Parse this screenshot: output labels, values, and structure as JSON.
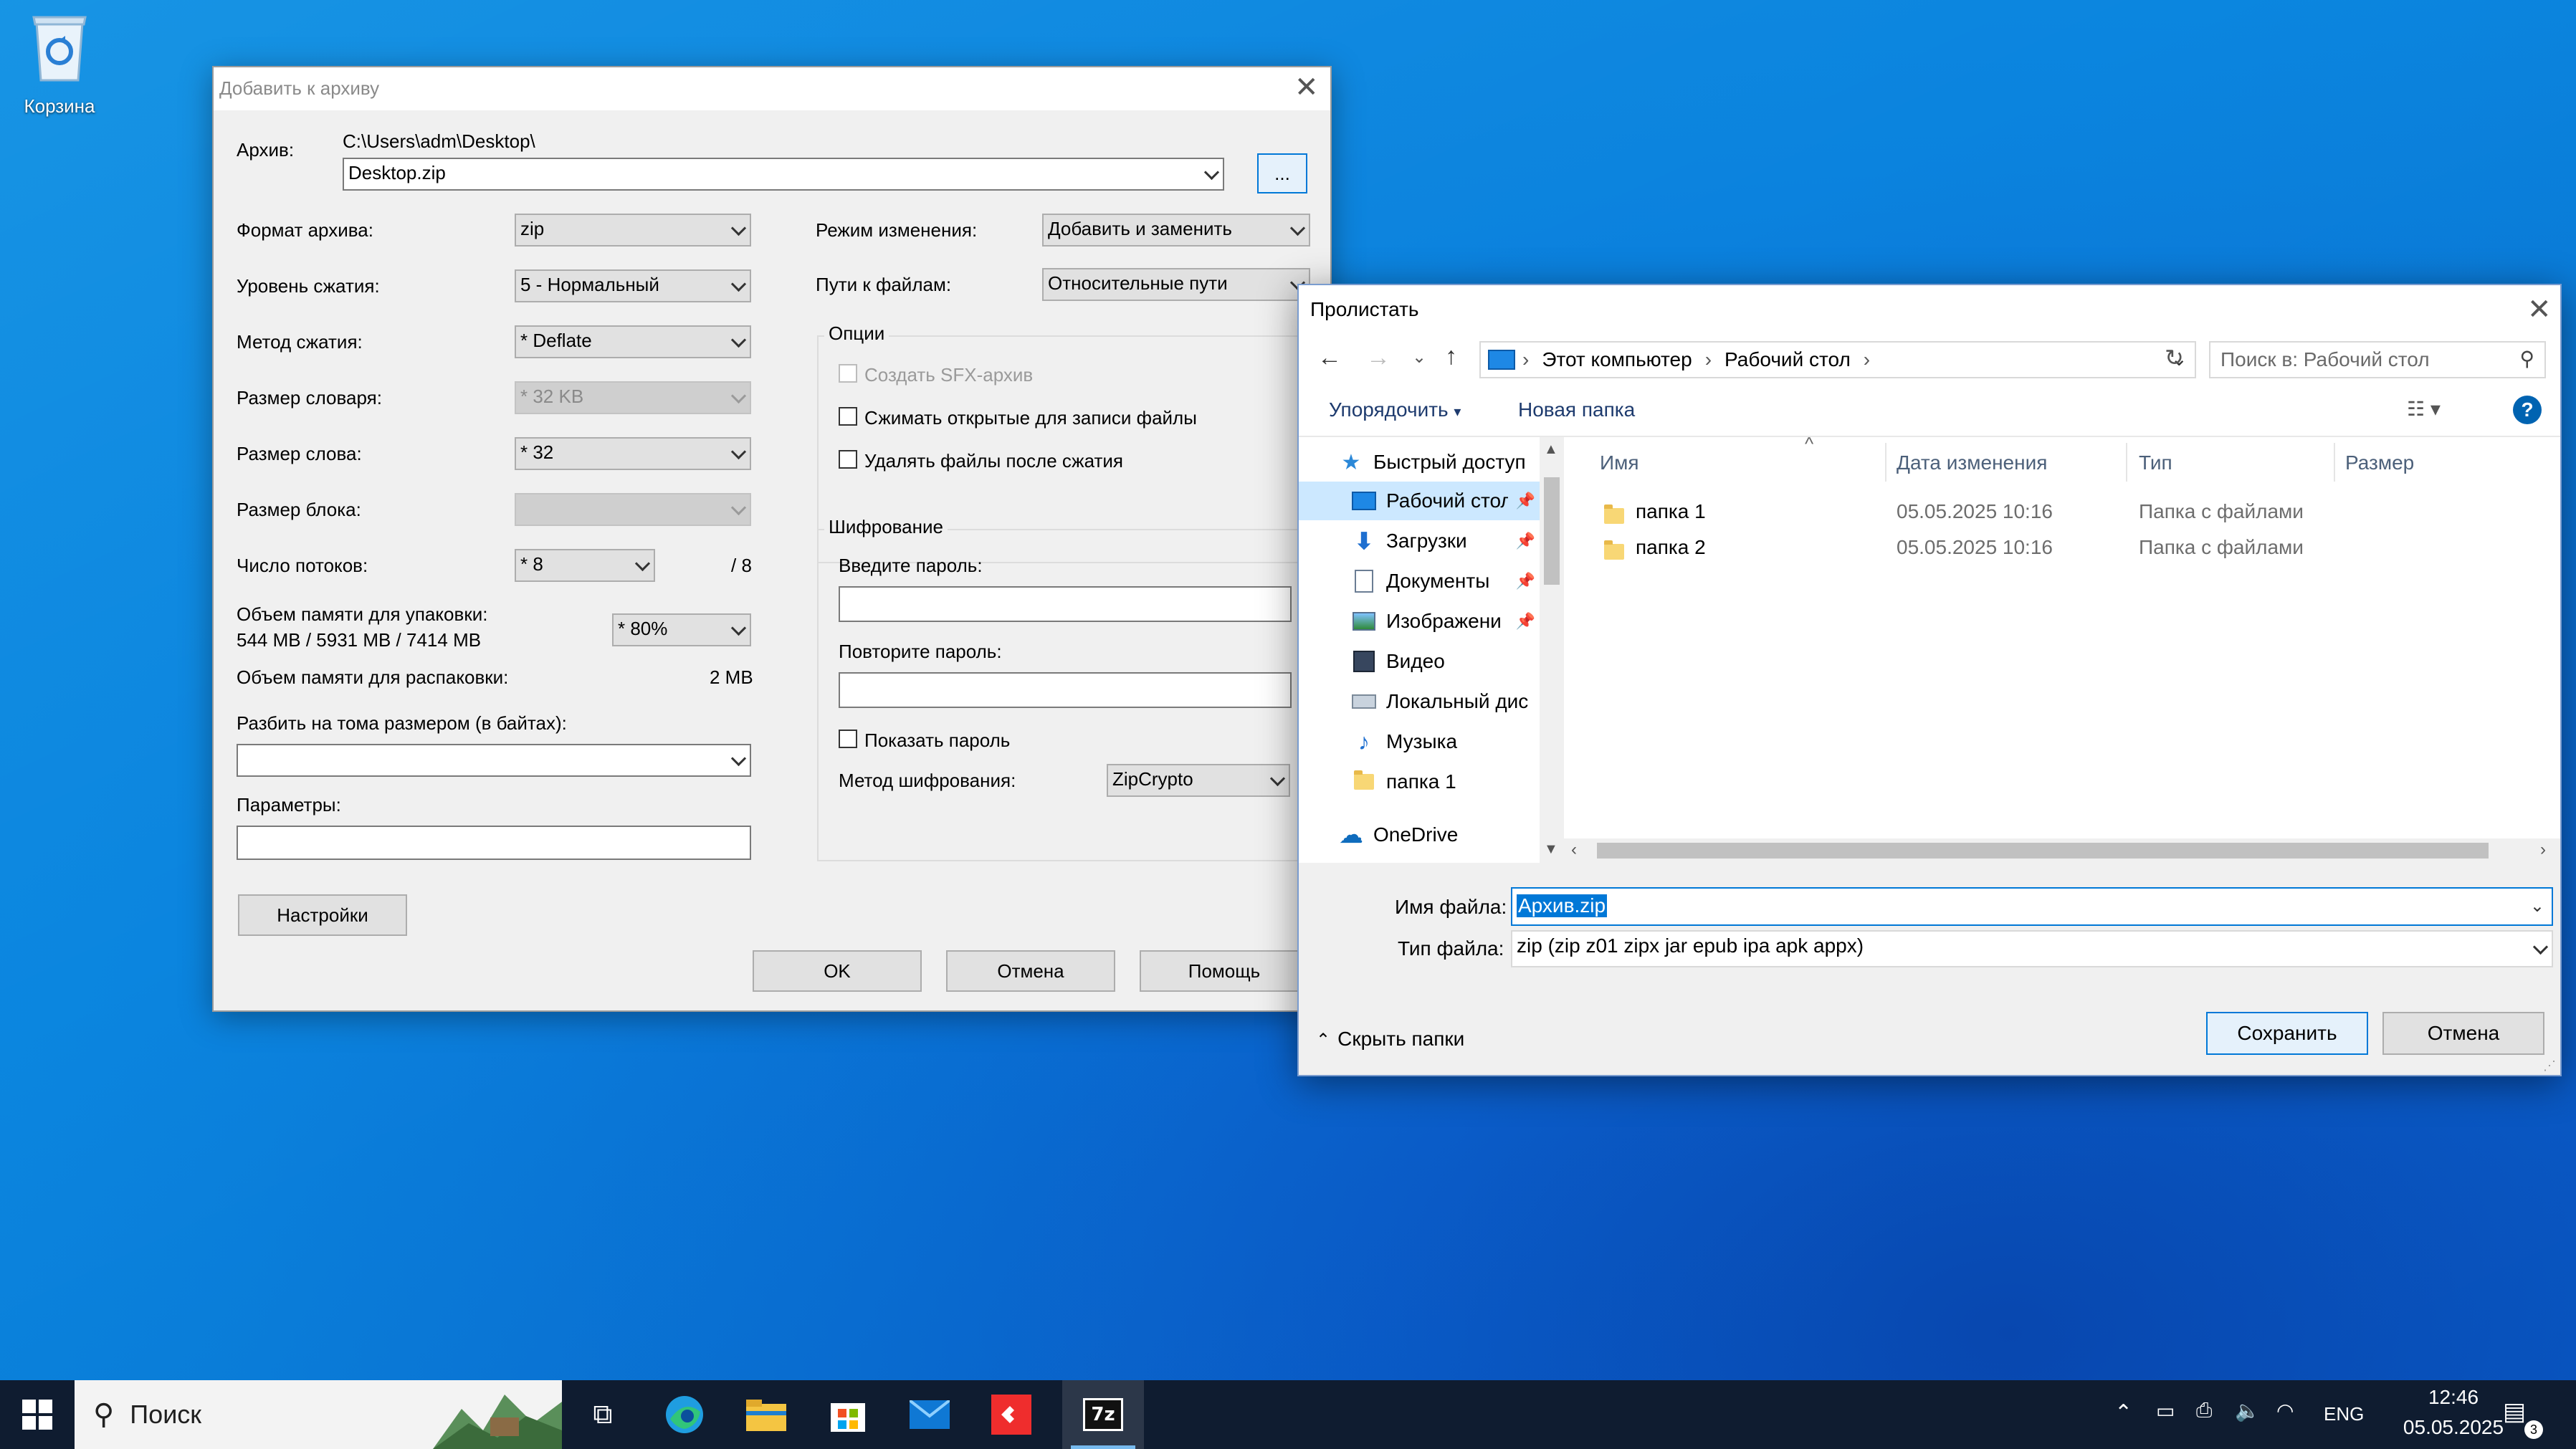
{
  "desktop": {
    "recycle_bin_label": "Корзина"
  },
  "archive_dialog": {
    "title": "Добавить к архиву",
    "archive_label": "Архив:",
    "archive_path": "C:\\Users\\adm\\Desktop\\",
    "archive_name": "Desktop.zip",
    "browse_label": "...",
    "format_label": "Формат архива:",
    "format_value": "zip",
    "level_label": "Уровень сжатия:",
    "level_value": "5 - Нормальный",
    "method_label": "Метод сжатия:",
    "method_value": "* Deflate",
    "dict_label": "Размер словаря:",
    "dict_value": "* 32 KB",
    "word_label": "Размер слова:",
    "word_value": "* 32",
    "block_label": "Размер блока:",
    "block_value": "",
    "threads_label": "Число потоков:",
    "threads_value": "* 8",
    "threads_max": "/ 8",
    "mem_pack_label": "Объем памяти для упаковки:",
    "mem_pack_detail": "544 MB / 5931 MB / 7414 MB",
    "mem_pack_value": "* 80%",
    "mem_unpack_label": "Объем памяти для распаковки:",
    "mem_unpack_value": "2 MB",
    "split_label": "Разбить на тома размером (в байтах):",
    "split_value": "",
    "params_label": "Параметры:",
    "params_value": "",
    "settings_button": "Настройки",
    "update_mode_label": "Режим изменения:",
    "update_mode_value": "Добавить и заменить",
    "paths_label": "Пути к файлам:",
    "paths_value": "Относительные пути",
    "options_group": "Опции",
    "opt_sfx": "Создать SFX-архив",
    "opt_open_files": "Сжимать открытые для записи файлы",
    "opt_delete": "Удалять файлы после сжатия",
    "encryption_group": "Шифрование",
    "password_label": "Введите пароль:",
    "password_repeat_label": "Повторите пароль:",
    "show_password": "Показать пароль",
    "enc_method_label": "Метод шифрования:",
    "enc_method_value": "ZipCrypto",
    "ok_button": "OK",
    "cancel_button": "Отмена",
    "help_button": "Помощь"
  },
  "browse_dialog": {
    "title": "Пролистать",
    "breadcrumb": [
      "Этот компьютер",
      "Рабочий стол"
    ],
    "search_placeholder": "Поиск в: Рабочий стол",
    "organize_label": "Упорядочить",
    "new_folder_label": "Новая папка",
    "nav_items": [
      {
        "label": "Быстрый доступ",
        "icon": "star-icon"
      },
      {
        "label": "Рабочий стол",
        "icon": "desktop-icon"
      },
      {
        "label": "Загрузки",
        "icon": "download-icon"
      },
      {
        "label": "Документы",
        "icon": "document-icon"
      },
      {
        "label": "Изображени",
        "icon": "pictures-icon"
      },
      {
        "label": "Видео",
        "icon": "video-icon"
      },
      {
        "label": "Локальный дис",
        "icon": "drive-icon"
      },
      {
        "label": "Музыка",
        "icon": "music-icon"
      },
      {
        "label": "папка 1",
        "icon": "folder-icon"
      },
      {
        "label": "OneDrive",
        "icon": "cloud-icon"
      }
    ],
    "columns": {
      "name": "Имя",
      "date": "Дата изменения",
      "type": "Тип",
      "size": "Размер"
    },
    "files": [
      {
        "name": "папка 1",
        "date": "05.05.2025 10:16",
        "type": "Папка с файлами"
      },
      {
        "name": "папка 2",
        "date": "05.05.2025 10:16",
        "type": "Папка с файлами"
      }
    ],
    "filename_label": "Имя файла:",
    "filename_value": "Архив.zip",
    "filetype_label": "Тип файла:",
    "filetype_value": "zip (zip z01 zipx jar epub ipa apk appx)",
    "hide_folders_label": "Скрыть папки",
    "save_button": "Сохранить",
    "cancel_button": "Отмена"
  },
  "taskbar": {
    "search_label": "Поиск",
    "language": "ENG",
    "time": "12:46",
    "date": "05.05.2025",
    "notification_count": "3",
    "active_app_label": "7z"
  },
  "colors": {
    "accent": "#0078d7",
    "selection": "#cce8ff",
    "taskbar": "#0f1c30",
    "desktop": "#0b7bd9"
  }
}
